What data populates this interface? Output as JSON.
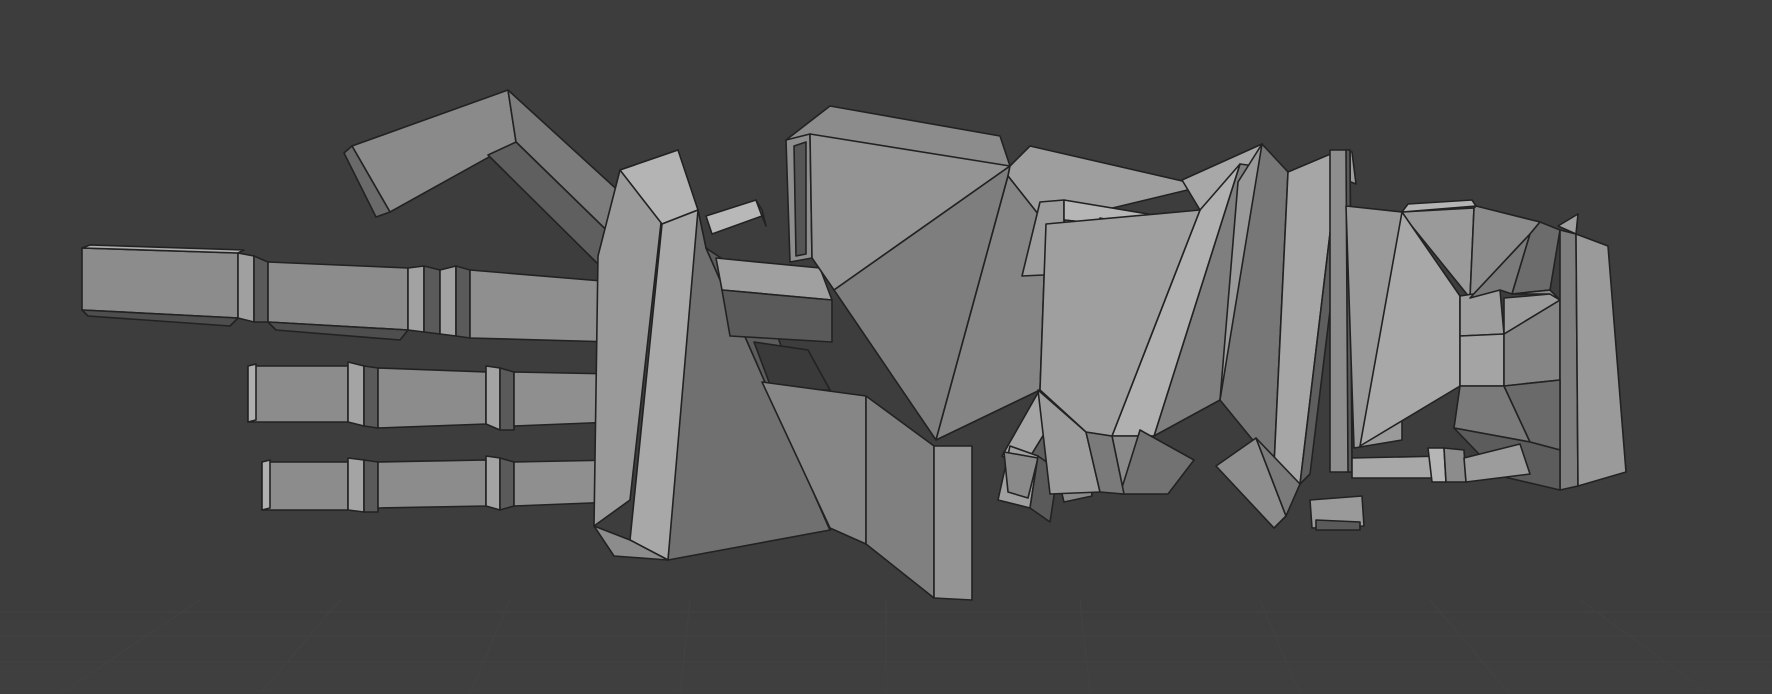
{
  "viewport": {
    "background": "#3d3d3d",
    "grid_color": "#454545",
    "object": {
      "name": "",
      "shading": "solid",
      "base_color": "#9a9a9a",
      "outline_color": "#1f1f1f"
    }
  }
}
